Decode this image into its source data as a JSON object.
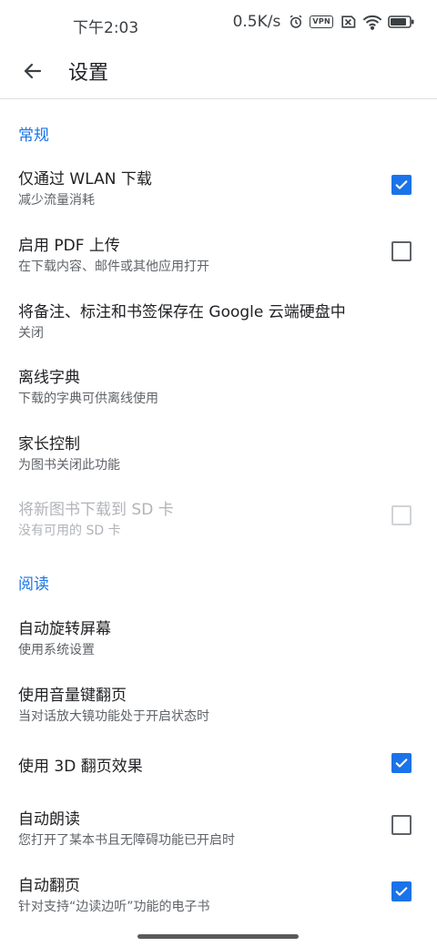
{
  "status_bar": {
    "time": "下午2:03",
    "net_speed": "0.5K/s",
    "vpn": "VPN",
    "battery_level": 0.85
  },
  "app_bar": {
    "title": "设置",
    "back_icon": "arrow-back-icon"
  },
  "sections": {
    "general": "常规",
    "reading": "阅读"
  },
  "prefs": {
    "wlan_only": {
      "title": "仅通过 WLAN 下载",
      "summary": "减少流量消耗",
      "checked": true
    },
    "pdf_upload": {
      "title": "启用 PDF 上传",
      "summary": "在下载内容、邮件或其他应用打开",
      "checked": false
    },
    "drive_save": {
      "title": "将备注、标注和书签保存在 Google 云端硬盘中",
      "summary": "关闭"
    },
    "offline_dict": {
      "title": "离线字典",
      "summary": "下载的字典可供离线使用"
    },
    "parental": {
      "title": "家长控制",
      "summary": "为图书关闭此功能"
    },
    "sd_card": {
      "title": "将新图书下载到 SD 卡",
      "summary": "没有可用的 SD 卡",
      "checked": false,
      "enabled": false
    },
    "auto_rotate": {
      "title": "自动旋转屏幕",
      "summary": "使用系统设置"
    },
    "volume_keys": {
      "title": "使用音量键翻页",
      "summary": "当对话放大镜功能处于开启状态时"
    },
    "page_3d": {
      "title": "使用 3D 翻页效果",
      "checked": true
    },
    "auto_read": {
      "title": "自动朗读",
      "summary": "您打开了某本书且无障碍功能已开启时",
      "checked": false
    },
    "auto_turn": {
      "title": "自动翻页",
      "summary": "针对支持“边读边听”功能的电子书",
      "checked": true
    }
  }
}
